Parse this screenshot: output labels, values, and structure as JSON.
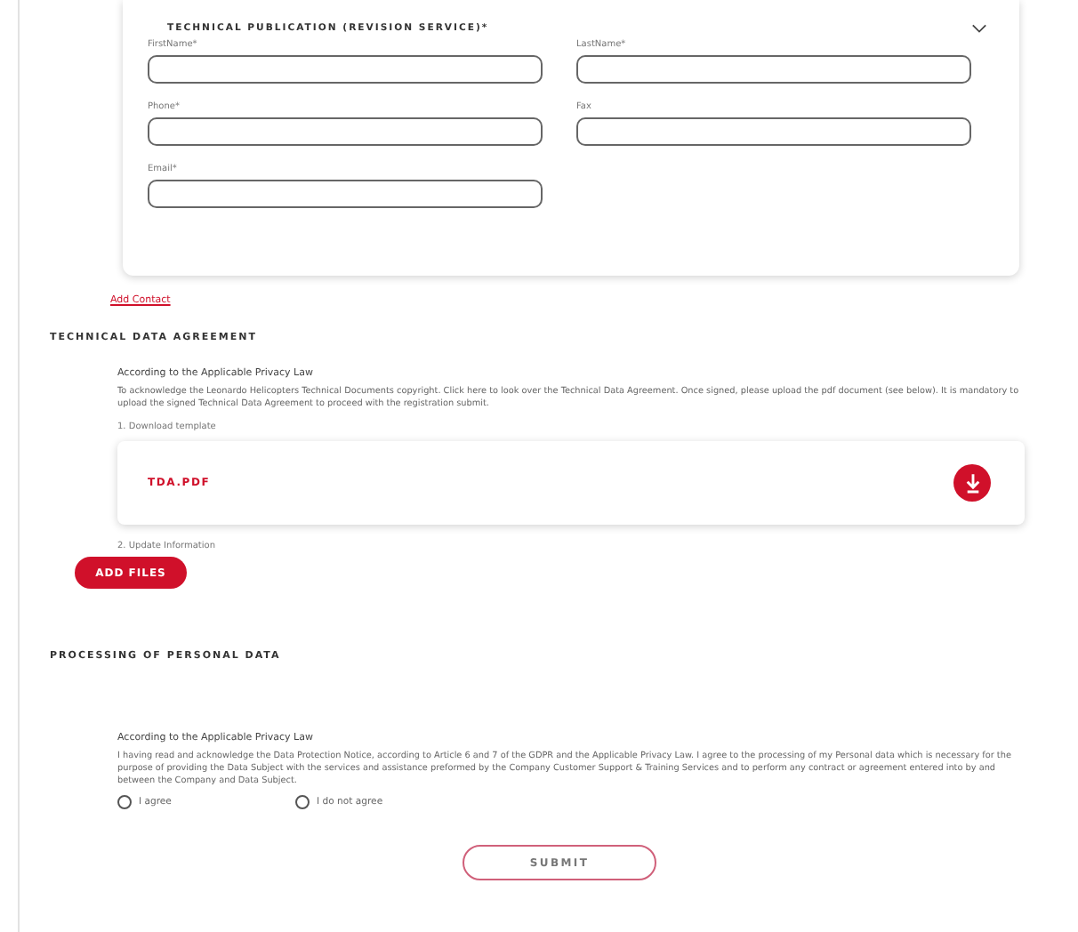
{
  "contact_card": {
    "title": "TECHNICAL PUBLICATION (REVISION SERVICE)*",
    "expanded": true,
    "fields": [
      {
        "label": "FirstName*"
      },
      {
        "label": "LastName*"
      },
      {
        "label": "Phone*"
      },
      {
        "label": "Fax"
      },
      {
        "label": "Email*"
      }
    ]
  },
  "add_contact": "Add Contact",
  "technical_data_agreement": {
    "heading": "TECHNICAL DATA AGREEMENT",
    "subheading": "According to the Applicable Privacy Law",
    "text": "To acknowledge the Leonardo Helicopters Technical Documents copyright. Click here to look over the Technical Data Agreement. Once signed, please upload the pdf document (see below). It is mandatory to upload the signed Technical Data Agreement to proceed with the registration submit.",
    "step_1": "1. Download template",
    "file_name": "TDA.PDF",
    "step_2": "2. Update Information",
    "add_files": "ADD FILES"
  },
  "processing_of_personal_data": {
    "heading": "PROCESSING OF PERSONAL DATA",
    "subheading": "According to the Applicable Privacy Law",
    "text": "I having read and acknowledge the Data Protection Notice, according to Article 6 and 7 of the GDPR and the Applicable Privacy Law. I agree to the processing of my Personal data which is necessary for the purpose of providing the Data Subject with the services and assistance preformed by the Company Customer Support & Training Services and to perform any contract or agreement entered into by and between the Company and Data Subject.",
    "options": [
      {
        "label": "I agree",
        "selected": false
      },
      {
        "label": "I do not agree",
        "selected": false
      }
    ]
  },
  "submit": "SUBMIT"
}
